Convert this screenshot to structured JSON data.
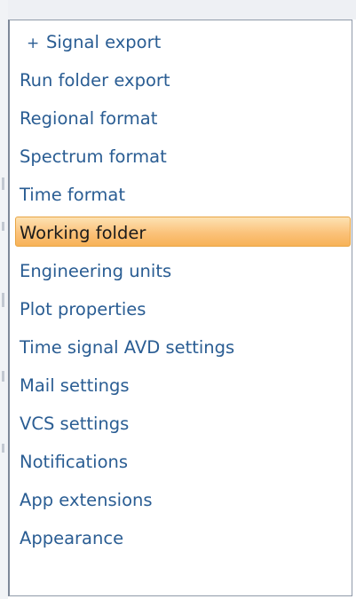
{
  "settings_tree": {
    "items": [
      {
        "label": "Signal export",
        "expander": "+",
        "selected": false
      },
      {
        "label": "Run folder export",
        "selected": false
      },
      {
        "label": "Regional format",
        "selected": false
      },
      {
        "label": "Spectrum format",
        "selected": false
      },
      {
        "label": "Time format",
        "selected": false
      },
      {
        "label": "Working folder",
        "selected": true
      },
      {
        "label": "Engineering units",
        "selected": false
      },
      {
        "label": "Plot properties",
        "selected": false
      },
      {
        "label": "Time signal AVD settings",
        "selected": false
      },
      {
        "label": "Mail settings",
        "selected": false
      },
      {
        "label": "VCS settings",
        "selected": false
      },
      {
        "label": "Notifications",
        "selected": false
      },
      {
        "label": "App extensions",
        "selected": false
      },
      {
        "label": "Appearance",
        "selected": false
      }
    ]
  },
  "colors": {
    "link_text": "#2a5d93",
    "selection_fill": "#fbc27a",
    "selection_border": "#e8a544",
    "panel_border": "#8f9aa9"
  }
}
